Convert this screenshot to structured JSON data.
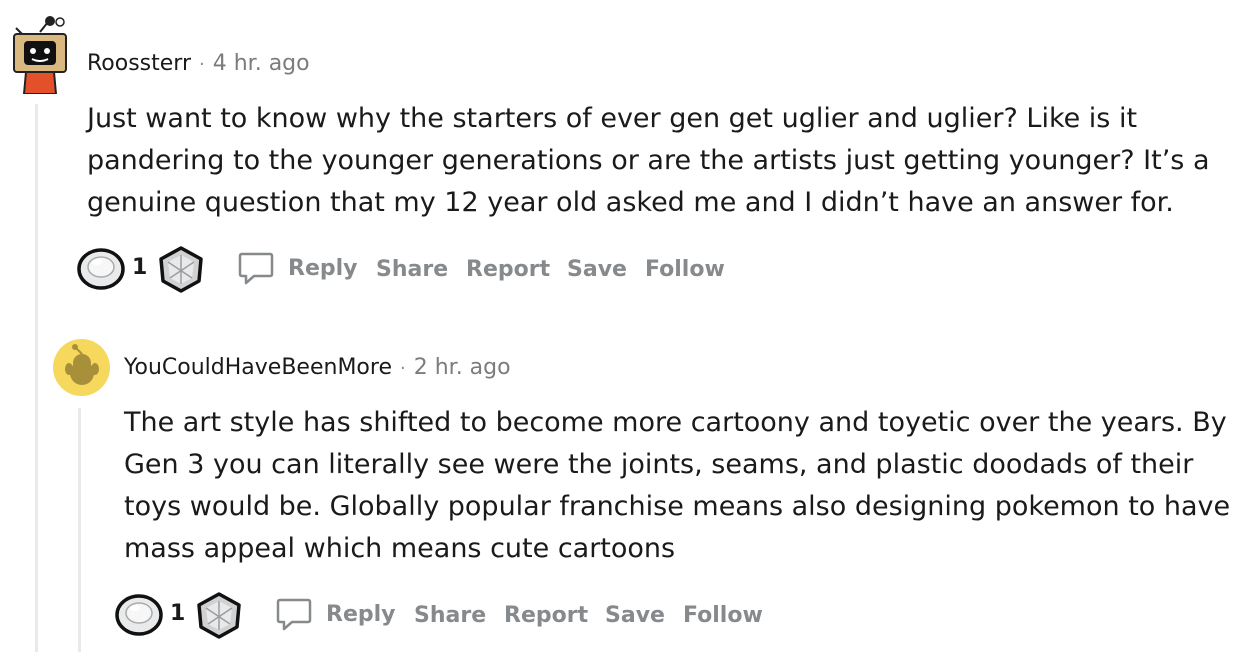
{
  "comments": [
    {
      "username": "Roossterr",
      "separator": "·",
      "time": "4 hr. ago",
      "lines": [
        "Just want to know why the starters of ever gen get uglier and uglier? Like is it",
        "pandering to the younger generations or are the artists just getting younger? It’s a",
        "genuine question that my 12 year old asked me and I didn’t have an answer for."
      ],
      "award_count": "1",
      "actions": {
        "reply": "Reply",
        "share": "Share",
        "report": "Report",
        "save": "Save",
        "follow": "Follow"
      }
    },
    {
      "username": "YouCouldHaveBeenMore",
      "separator": "·",
      "time": "2 hr. ago",
      "lines": [
        "The art style has shifted to become more cartoony and toyetic over the years. By",
        "Gen 3 you can literally see were the joints, seams, and plastic doodads of their",
        "toys would be. Globally popular franchise means also designing pokemon to have",
        "mass appeal which means cute cartoons"
      ],
      "award_count": "1",
      "actions": {
        "reply": "Reply",
        "share": "Share",
        "report": "Report",
        "save": "Save",
        "follow": "Follow"
      }
    }
  ],
  "icons": {
    "award_1": "silver-award-icon",
    "award_2": "gem-award-icon",
    "reply": "chat-bubble-icon"
  },
  "colors": {
    "text": "#1a1a1b",
    "meta": "#7c7c7c",
    "action": "#878a8c",
    "thread_line": "#e7e9ea",
    "avatar_2_bg": "#f6d85c"
  }
}
